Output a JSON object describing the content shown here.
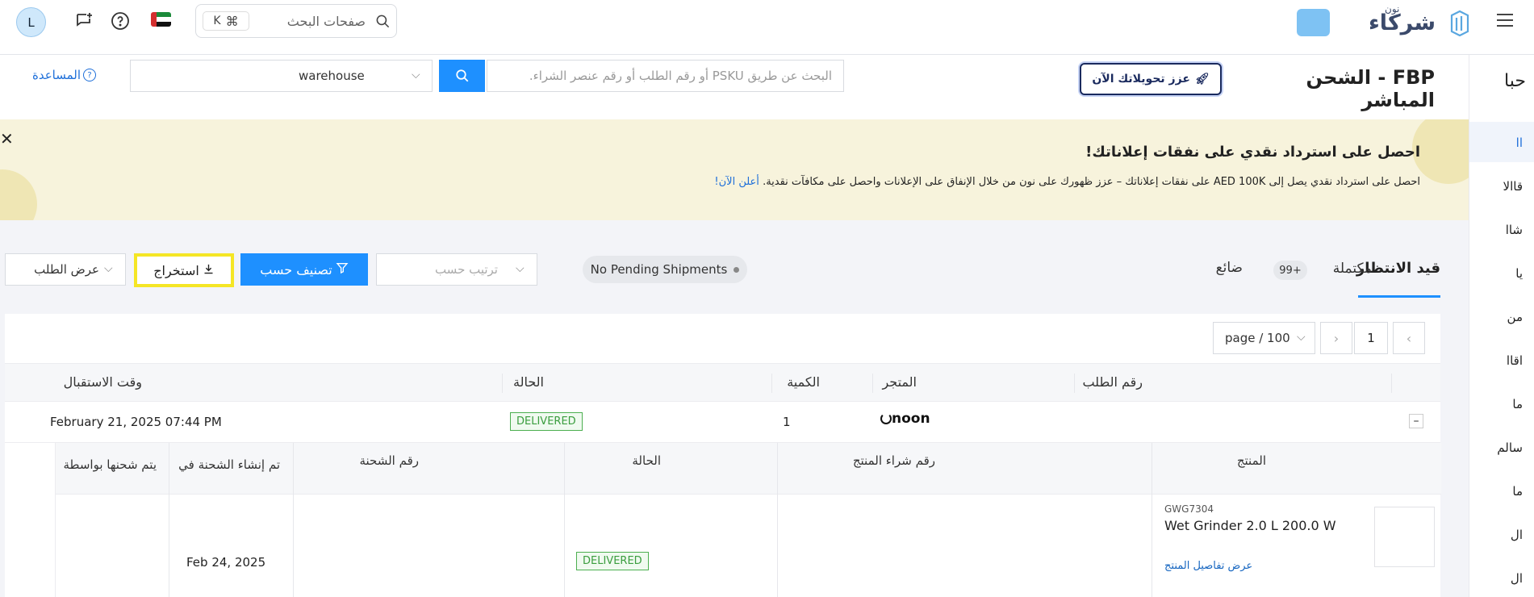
{
  "header": {
    "brand_small": "نون",
    "brand_name": "شركاء",
    "search_placeholder": "صفحات البحث",
    "shortcut_key": "K",
    "avatar_letter": "L"
  },
  "subheader": {
    "page_title": "FBP - الشحن المباشر",
    "boost_button": "عزز تحويلاتك الآن",
    "search_placeholder": "البحث عن طريق PSKU أو رقم الطلب أو رقم عنصر الشراء.",
    "warehouse_value": "warehouse",
    "help_link": "المساعدة"
  },
  "sidebar": {
    "title": "حبا",
    "items": [
      "اا",
      "قاالا",
      "شاا",
      "يا",
      "من",
      "اقاا",
      "ما",
      "سالم",
      "ما",
      "ال",
      "ال"
    ]
  },
  "banner": {
    "headline": "احصل على استرداد نقدي على نفقات إعلاناتك!",
    "body": "احصل على استرداد نقدي يصل إلى AED 100K على نفقات إعلاناتك – عزز ظهورك على نون من خلال الإنفاق على الإعلانات واحصل على مكافآت نقدية.",
    "cta": "أعلن الآن!"
  },
  "tabs": {
    "pending": "قيد الانتظار",
    "completed": "مكتملة",
    "completed_count": "99+",
    "lost": "ضائع"
  },
  "toolbar": {
    "pending_status": "No Pending Shipments",
    "sort_placeholder": "ترتيب حسب",
    "filter_button": "تصنيف حسب",
    "export_button": "استخراج",
    "view_select": "عرض الطلب"
  },
  "pagination": {
    "current_page": "1",
    "per_page": "100 / page",
    "per_page_display": "page / 100"
  },
  "orders_table": {
    "headers": {
      "order_number": "رقم الطلب",
      "store": "المتجر",
      "quantity": "الكمية",
      "status": "الحالة",
      "received_time": "وقت الاستقبال"
    },
    "row": {
      "store_logo": "noon",
      "quantity": "1",
      "status": "DELIVERED",
      "received_time": "February 21, 2025 07:44 PM"
    }
  },
  "items_table": {
    "headers": {
      "product": "المنتج",
      "purchase_number": "رقم شراء المنتج",
      "status": "الحالة",
      "shipment_number": "رقم الشحنة",
      "shipment_created": "تم إنشاء الشحنة في",
      "shipped_by": "يتم شحنها بواسطة"
    },
    "row": {
      "sku": "GWG7304",
      "product_name": "Wet Grinder 2.0 L 200.0 W",
      "details_link": "عرض تفاصيل المنتج",
      "status": "DELIVERED",
      "created_date": "Feb 24, 2025"
    }
  },
  "colors": {
    "primary": "#1e90ff",
    "highlight": "#f5e625",
    "banner_bg": "#f7f3dc",
    "delivered": "#3a9d3e",
    "link": "#1565c0"
  }
}
